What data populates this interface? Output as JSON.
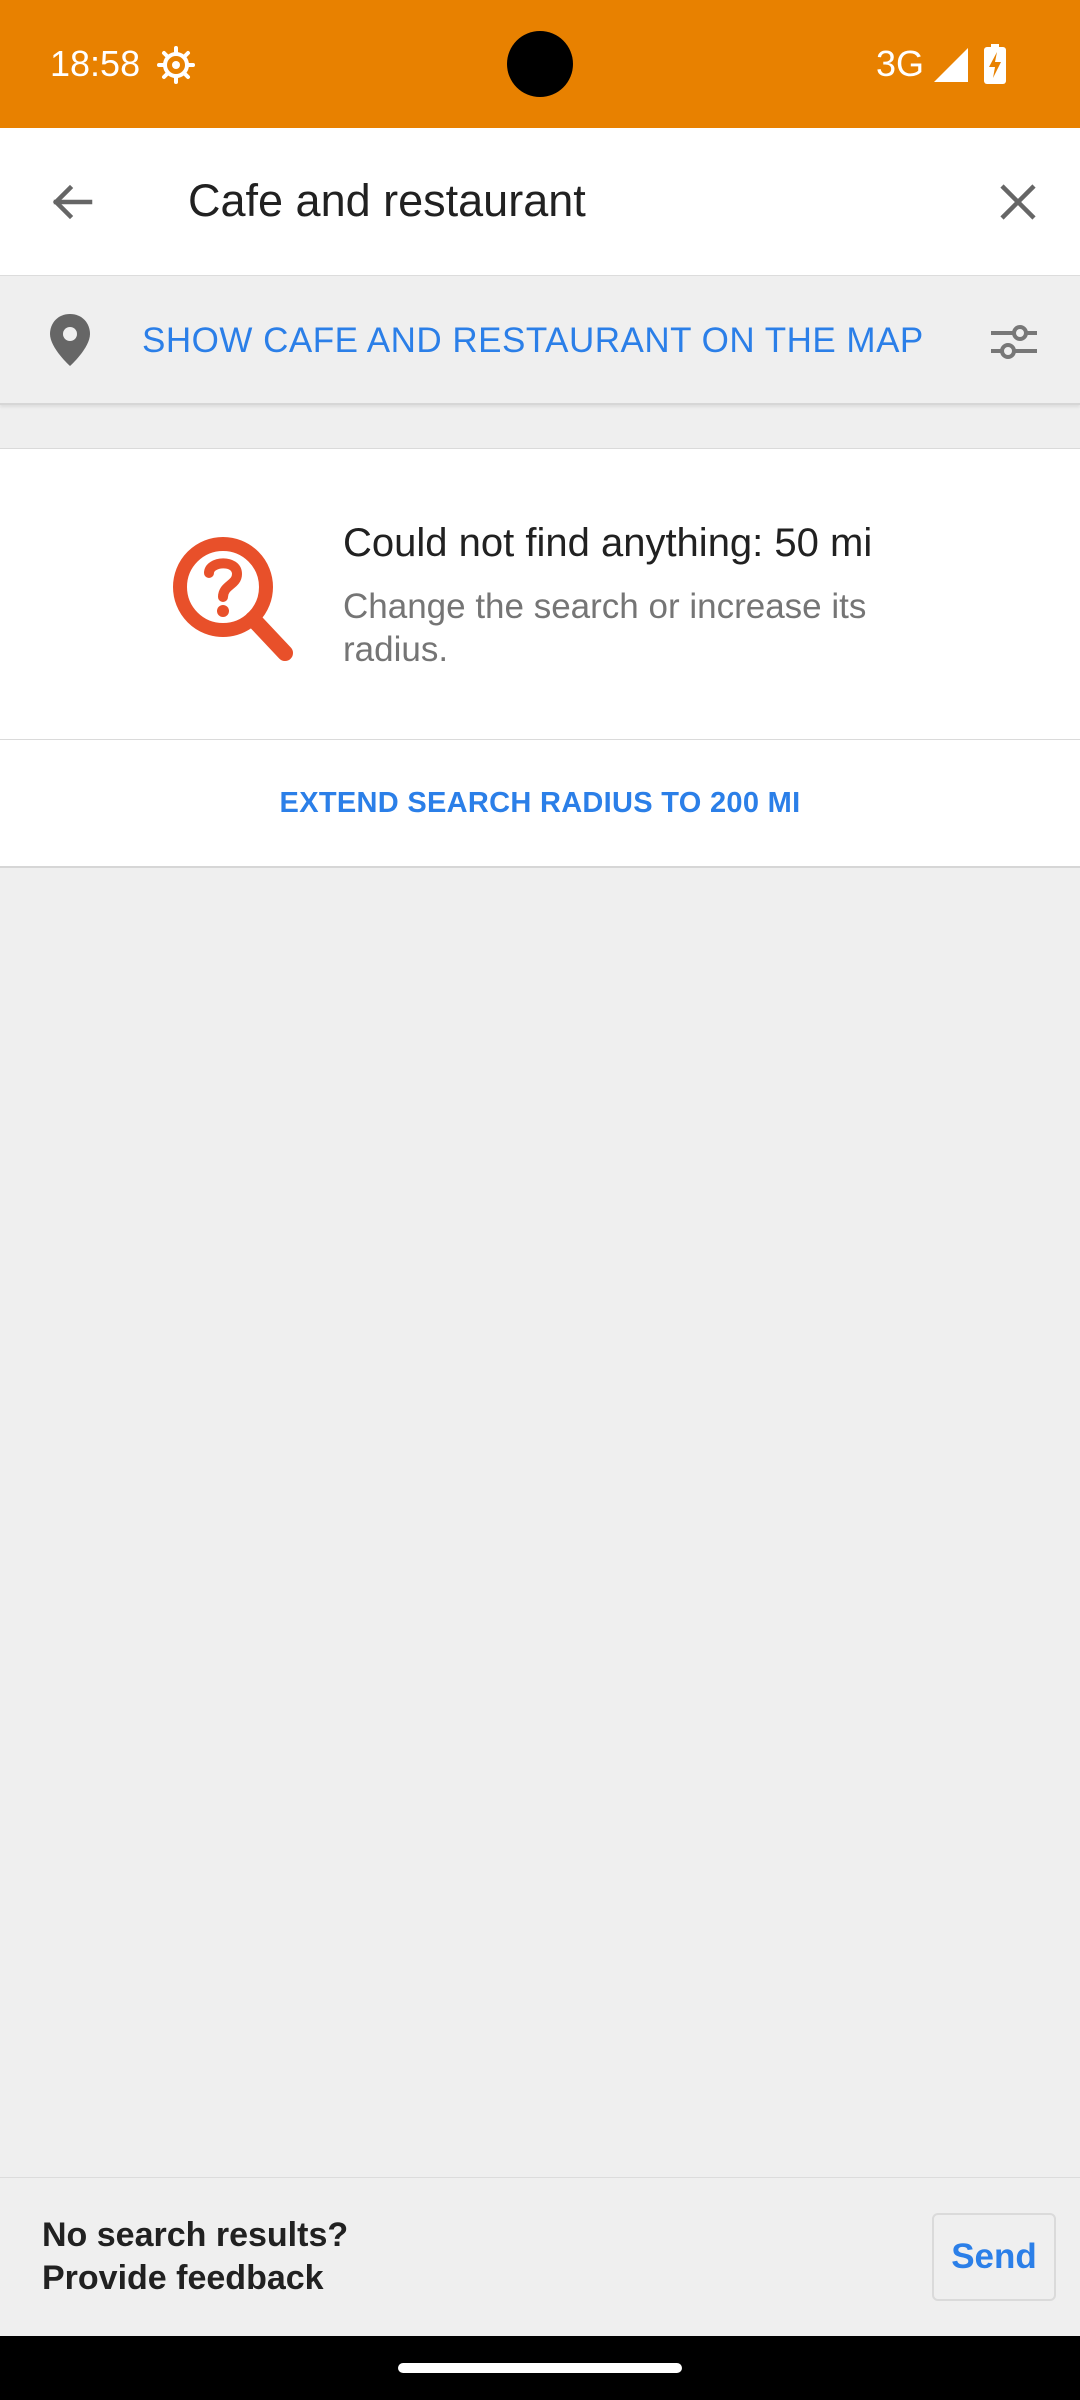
{
  "status_bar": {
    "time": "18:58",
    "network": "3G",
    "background_color": "#e88100",
    "icons": [
      "gear-icon",
      "signal-icon",
      "battery-charging-icon"
    ]
  },
  "search": {
    "query": "Cafe and restaurant",
    "back_icon": "arrow-back-icon",
    "clear_icon": "close-icon"
  },
  "show_on_map": {
    "label": "SHOW CAFE AND RESTAURANT ON THE MAP",
    "icon": "location-pin-icon",
    "filter_icon": "sliders-icon"
  },
  "empty_state": {
    "title": "Could not find anything: 50 mi",
    "subtitle": "Change the search or increase its radius.",
    "icon": "search-question-icon",
    "icon_color": "#e8502a"
  },
  "extend_radius": {
    "label": "EXTEND SEARCH RADIUS TO 200 MI"
  },
  "feedback": {
    "line1": "No search results?",
    "line2": "Provide feedback",
    "send_label": "Send"
  },
  "accent_color": "#2b7fe8"
}
